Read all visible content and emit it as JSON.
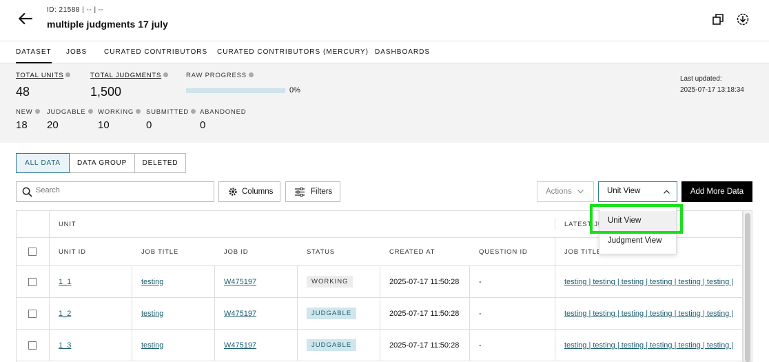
{
  "header": {
    "meta": "ID: 21588  |  --  |  --",
    "title": "multiple judgments 17 july"
  },
  "tabs": [
    {
      "label": "DATASET",
      "active": true
    },
    {
      "label": "JOBS"
    },
    {
      "label": "CURATED CONTRIBUTORS"
    },
    {
      "label": "CURATED CONTRIBUTORS (MERCURY)"
    },
    {
      "label": "DASHBOARDS"
    }
  ],
  "stats": {
    "total_units": {
      "label": "TOTAL UNITS",
      "value": "48"
    },
    "total_judgments": {
      "label": "TOTAL JUDGMENTS",
      "value": "1,500"
    },
    "raw_progress": {
      "label": "RAW PROGRESS",
      "percent": 0,
      "text": "0%"
    },
    "new": {
      "label": "NEW",
      "value": "18"
    },
    "judgable": {
      "label": "JUDGABLE",
      "value": "20"
    },
    "working": {
      "label": "WORKING",
      "value": "10"
    },
    "submitted": {
      "label": "SUBMITTED",
      "value": "0"
    },
    "abandoned": {
      "label": "ABANDONED",
      "value": "0"
    },
    "updated_label": "Last updated:",
    "updated_value": "2025-07-17 13:18:34"
  },
  "segments": [
    "ALL DATA",
    "DATA GROUP",
    "DELETED"
  ],
  "toolbar": {
    "search_placeholder": "Search",
    "columns_label": "Columns",
    "filters_label": "Filters",
    "actions_label": "Actions",
    "view_label": "Unit View",
    "add_label": "Add More Data"
  },
  "dropdown": {
    "options": [
      "Unit View",
      "Judgment View"
    ],
    "selected": "Unit View"
  },
  "table": {
    "group_unit": "UNIT",
    "group_latest": "LATEST JU",
    "columns": [
      "UNIT ID",
      "JOB TITLE",
      "JOB ID",
      "STATUS",
      "CREATED AT",
      "QUESTION ID",
      "JOB TITLE"
    ],
    "rows": [
      {
        "unit_id": "1_1",
        "job_title": "testing",
        "job_id": "W475197",
        "status": "WORKING",
        "created": "2025-07-17 11:50:28",
        "question": "-",
        "latest": "testing | testing | testing | testing | testing | testing |"
      },
      {
        "unit_id": "1_2",
        "job_title": "testing",
        "job_id": "W475197",
        "status": "JUDGABLE",
        "created": "2025-07-17 11:50:28",
        "question": "-",
        "latest": "testing | testing | testing | testing | testing | testing |"
      },
      {
        "unit_id": "1_3",
        "job_title": "testing",
        "job_id": "W475197",
        "status": "JUDGABLE",
        "created": "2025-07-17 11:50:28",
        "question": "-",
        "latest": "testing | testing | testing | testing | testing | testing |"
      }
    ]
  },
  "colors": {
    "accent": "#2f7d94",
    "highlight": "#18e018",
    "primary_button": "#000000"
  }
}
